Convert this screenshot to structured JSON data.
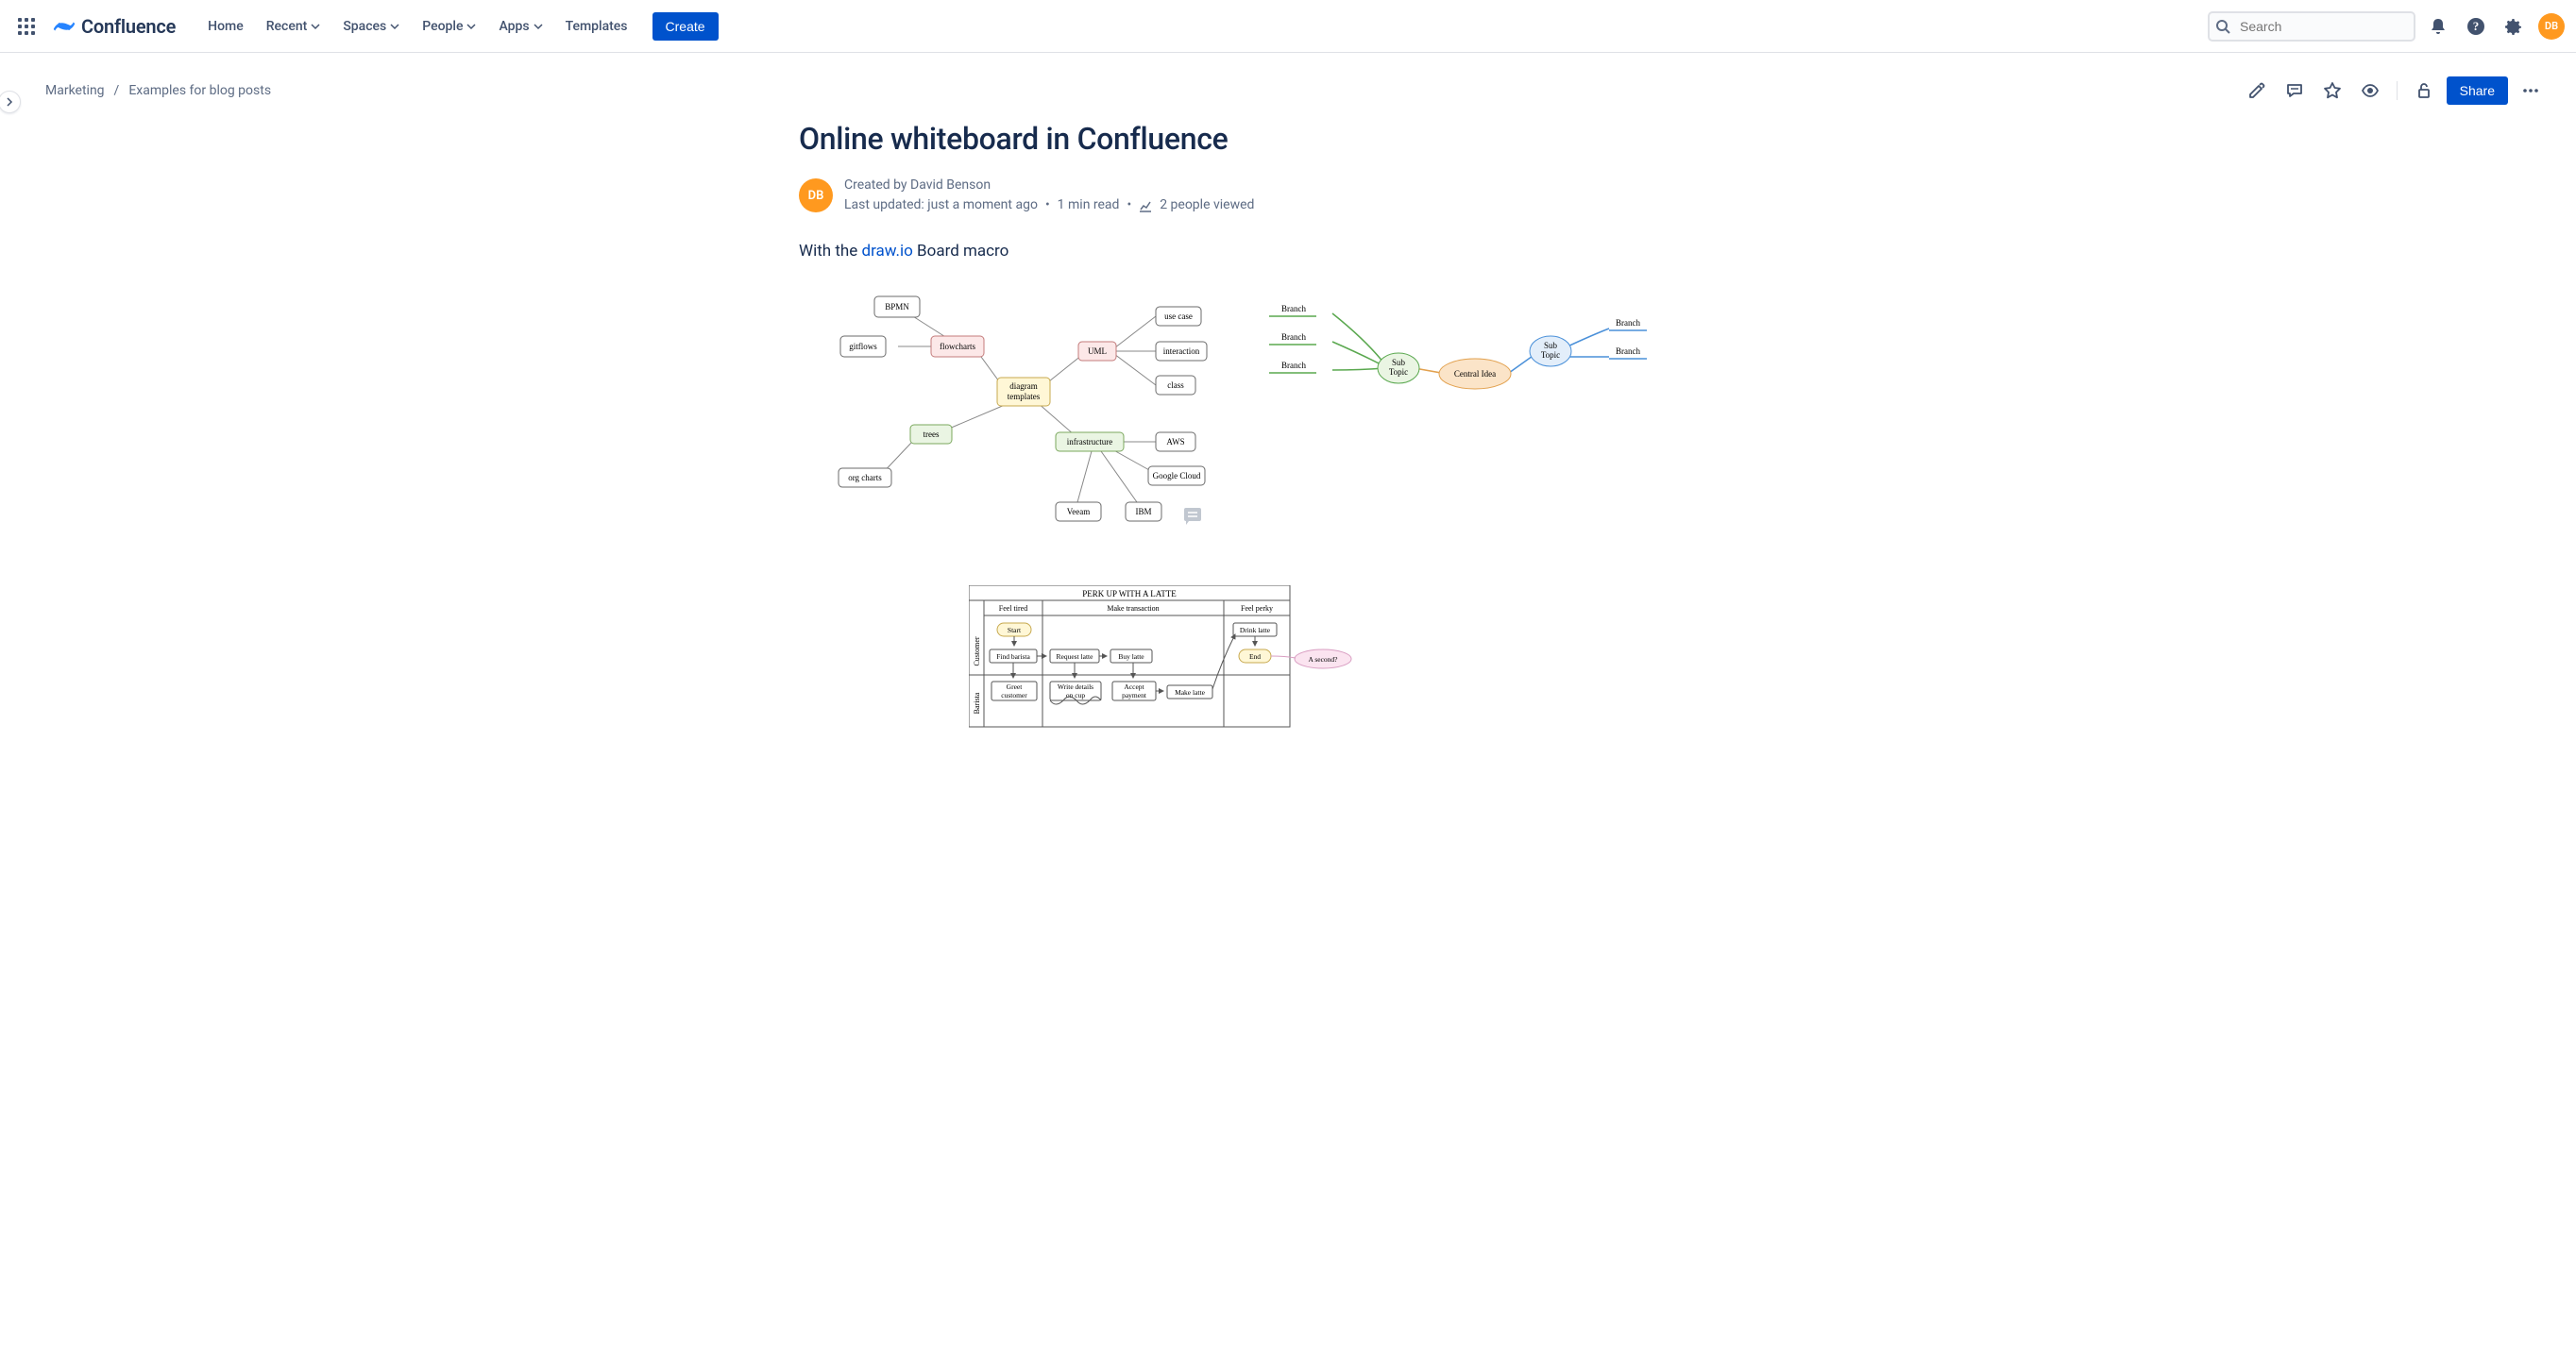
{
  "app": {
    "name": "Confluence"
  },
  "nav": {
    "home": "Home",
    "recent": "Recent",
    "spaces": "Spaces",
    "people": "People",
    "apps": "Apps",
    "templates": "Templates",
    "create": "Create"
  },
  "search": {
    "placeholder": "Search"
  },
  "user": {
    "initials": "DB"
  },
  "breadcrumb": {
    "space": "Marketing",
    "parent": "Examples for blog posts"
  },
  "page": {
    "title": "Online whiteboard in Confluence",
    "share": "Share",
    "created_by_prefix": "Created by ",
    "author": "David Benson",
    "updated": "Last updated: just a moment ago",
    "read_time": "1 min read",
    "views": "2 people viewed",
    "intro_prefix": "With the ",
    "intro_link": "draw.io",
    "intro_suffix": " Board macro"
  },
  "diagram1": {
    "nodes": {
      "bpmn": "BPMN",
      "gitflows": "gitflows",
      "flowcharts": "flowcharts",
      "diagram_templates_l1": "diagram",
      "diagram_templates_l2": "templates",
      "uml": "UML",
      "usecase": "use case",
      "interaction": "interaction",
      "class": "class",
      "trees": "trees",
      "orgcharts": "org charts",
      "infrastructure": "infrastructure",
      "aws": "AWS",
      "googlecloud": "Google Cloud",
      "veeam": "Veeam",
      "ibm": "IBM"
    }
  },
  "diagram2": {
    "central": "Central Idea",
    "sub_l1": "Sub",
    "sub_l2": "Topic",
    "branch": "Branch"
  },
  "swimlane": {
    "title": "PERK UP WITH A LATTE",
    "lanes": {
      "customer": "Customer",
      "barista": "Barista"
    },
    "phases": {
      "tired": "Feel tired",
      "transaction": "Make transaction",
      "perky": "Feel perky"
    },
    "nodes": {
      "start": "Start",
      "find_barista": "Find barista",
      "request_latte": "Request latte",
      "buy_latte": "Buy latte",
      "drink_latte": "Drink latte",
      "end": "End",
      "greet": "Greet",
      "greet2": "customer",
      "write_details": "Write details",
      "write_details2": "on cup",
      "accept_payment": "Accept",
      "accept_payment2": "payment",
      "make_latte": "Make latte",
      "a_second": "A second?"
    }
  }
}
